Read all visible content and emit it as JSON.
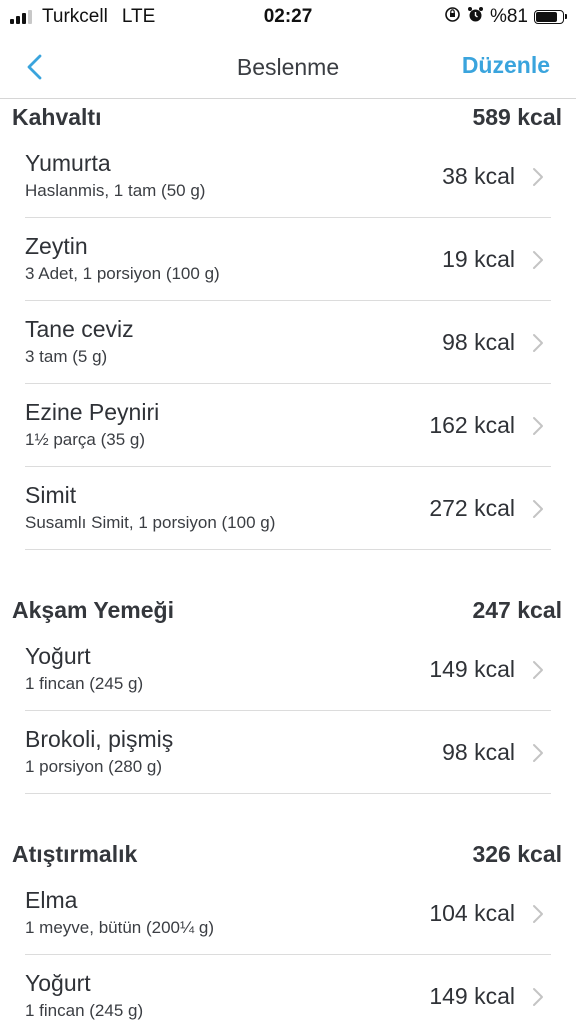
{
  "status_bar": {
    "carrier": "Turkcell",
    "network": "LTE",
    "time": "02:27",
    "battery_text": "%81",
    "battery_level": 0.81,
    "signal_bars": 3,
    "icons": [
      "orientation-lock-icon",
      "alarm-icon"
    ]
  },
  "nav": {
    "title": "Beslenme",
    "edit_label": "Düzenle",
    "back_icon": "chevron-left-icon",
    "accent_color": "#3aa4dd"
  },
  "sections": [
    {
      "title": "Kahvaltı",
      "total": "589 kcal",
      "items": [
        {
          "name": "Yumurta",
          "detail": "Haslanmis, 1 tam (50 g)",
          "kcal": "38 kcal"
        },
        {
          "name": "Zeytin",
          "detail": "3 Adet, 1 porsiyon (100 g)",
          "kcal": "19 kcal"
        },
        {
          "name": "Tane ceviz",
          "detail": "3 tam (5 g)",
          "kcal": "98 kcal"
        },
        {
          "name": "Ezine Peyniri",
          "detail": "1½ parça (35 g)",
          "kcal": "162 kcal"
        },
        {
          "name": "Simit",
          "detail": "Susamlı Simit, 1 porsiyon (100 g)",
          "kcal": "272 kcal"
        }
      ]
    },
    {
      "title": "Akşam Yemeği",
      "total": "247 kcal",
      "items": [
        {
          "name": "Yoğurt",
          "detail": "1 fincan (245 g)",
          "kcal": "149 kcal"
        },
        {
          "name": "Brokoli, pişmiş",
          "detail": "1 porsiyon (280 g)",
          "kcal": "98 kcal"
        }
      ]
    },
    {
      "title": "Atıştırmalık",
      "total": "326 kcal",
      "items": [
        {
          "name": "Elma",
          "detail": "1 meyve, bütün (200¼ g)",
          "kcal": "104 kcal"
        },
        {
          "name": "Yoğurt",
          "detail": "1 fincan (245 g)",
          "kcal": "149 kcal"
        }
      ]
    }
  ]
}
